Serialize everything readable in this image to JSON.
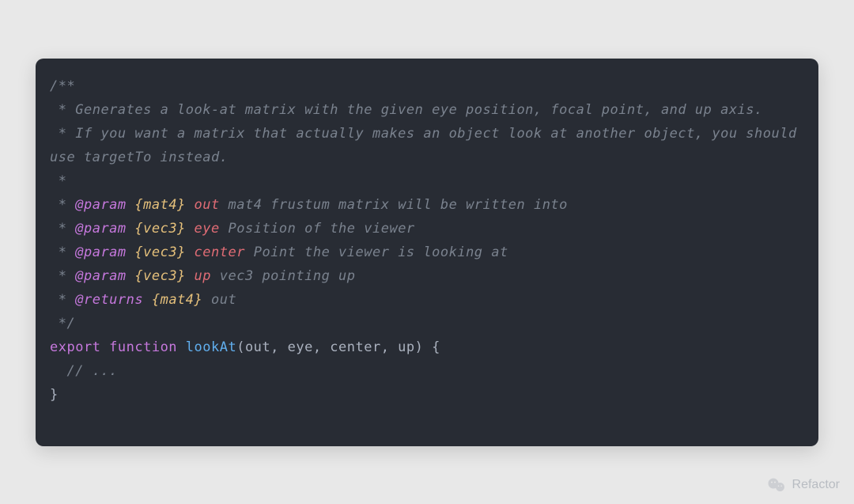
{
  "code": {
    "line1": "/**",
    "line2_pre": " * ",
    "line2_text": "Generates a look-at matrix with the given eye position, focal point, and up axis.",
    "line3_pre": " * ",
    "line3_text": "If you want a matrix that actually makes an object look at another object, you should use targetTo instead.",
    "line4": " *",
    "line5_pre": " * ",
    "line5_tag": "@param",
    "line5_type": " {mat4}",
    "line5_name": " out",
    "line5_desc": " mat4 frustum matrix will be written into",
    "line6_pre": " * ",
    "line6_tag": "@param",
    "line6_type": " {vec3}",
    "line6_name": " eye",
    "line6_desc": " Position of the viewer",
    "line7_pre": " * ",
    "line7_tag": "@param",
    "line7_type": " {vec3}",
    "line7_name": " center",
    "line7_desc": " Point the viewer is looking at",
    "line8_pre": " * ",
    "line8_tag": "@param",
    "line8_type": " {vec3}",
    "line8_name": " up",
    "line8_desc": " vec3 pointing up",
    "line9_pre": " * ",
    "line9_tag": "@returns",
    "line9_type": " {mat4}",
    "line9_desc": " out",
    "line10": " */",
    "line11_export": "export",
    "line11_function": " function",
    "line11_fnname": " lookAt",
    "line11_params": "(out, eye, center, up) {",
    "line12": "  // ...",
    "line13": "}"
  },
  "watermark": {
    "label": "Refactor"
  }
}
